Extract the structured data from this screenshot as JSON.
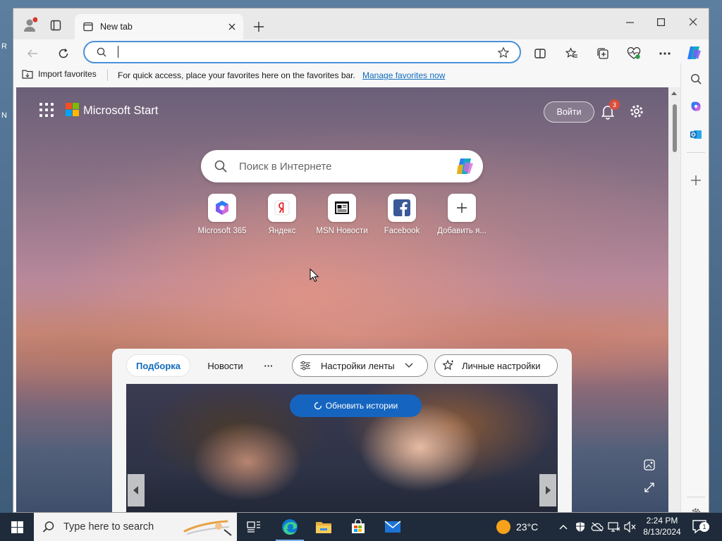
{
  "colors": {
    "accent": "#0f6cbd",
    "taskbar": "#1f2b3a",
    "refresh_button": "#1565c0",
    "badge": "#d94e3c",
    "copilot": "#2f7bf5"
  },
  "desktop": {
    "letters": [
      "R",
      "N"
    ]
  },
  "browser": {
    "tab": {
      "title": "New tab",
      "icon": "tab-page-icon"
    },
    "address": {
      "value": "",
      "placeholder": ""
    },
    "favorites_bar": {
      "import_label": "Import favorites",
      "hint": "For quick access, place your favorites here on the favorites bar.",
      "manage_link": "Manage favorites now"
    },
    "sidebar_icons": [
      "search-icon",
      "copilot-icon",
      "outlook-icon",
      "add-icon",
      "settings-icon"
    ]
  },
  "start_page": {
    "brand": "Microsoft Start",
    "signin_label": "Войти",
    "notification_count": "3",
    "search_placeholder": "Поиск в Интернете",
    "quick_links": [
      {
        "label": "Microsoft 365",
        "icon": "m365-icon"
      },
      {
        "label": "Яндекс",
        "icon": "yandex-icon"
      },
      {
        "label": "MSN Новости",
        "icon": "msn-news-icon"
      },
      {
        "label": "Facebook",
        "icon": "facebook-icon"
      },
      {
        "label": "Добавить я...",
        "icon": "plus-icon"
      }
    ],
    "feed": {
      "tabs": [
        "Подборка",
        "Новости"
      ],
      "more": "···",
      "feed_settings": "Настройки ленты",
      "personal_settings": "Личные настройки",
      "refresh_label": "Обновить истории"
    }
  },
  "taskbar": {
    "search_placeholder": "Type here to search",
    "weather": "23°C",
    "time": "2:24 PM",
    "date": "8/13/2024",
    "notification_count": "1"
  }
}
